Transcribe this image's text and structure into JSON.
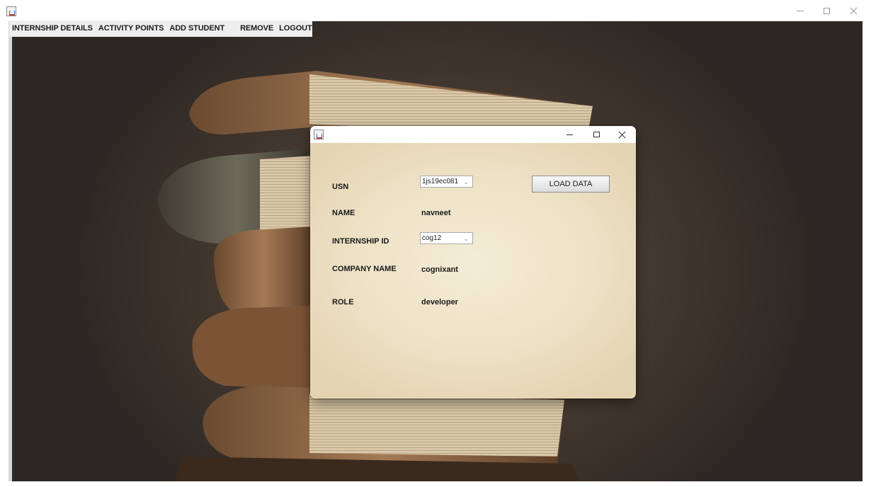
{
  "menu": {
    "items": [
      "INTERNSHIP DETAILS",
      "ACTIVITY POINTS",
      "ADD STUDENT",
      "REMOVE",
      "LOGOUT"
    ]
  },
  "dialog": {
    "usn_label": "USN",
    "usn_value": "1js19ec081",
    "name_label": "NAME",
    "name_value": "navneet",
    "internship_id_label": "INTERNSHIP ID",
    "internship_id_value": "cog12",
    "company_name_label": "COMPANY NAME",
    "company_name_value": "cognixant",
    "role_label": "ROLE",
    "role_value": "developer",
    "load_button": "LOAD DATA"
  },
  "icons": {
    "app": "java-cup-icon",
    "dropdown": "chevron-down-icon"
  },
  "colors": {
    "dialog_background": "#efe4c8",
    "menubar_background": "#eeeeee",
    "desktop_background": "#4a3d33"
  }
}
